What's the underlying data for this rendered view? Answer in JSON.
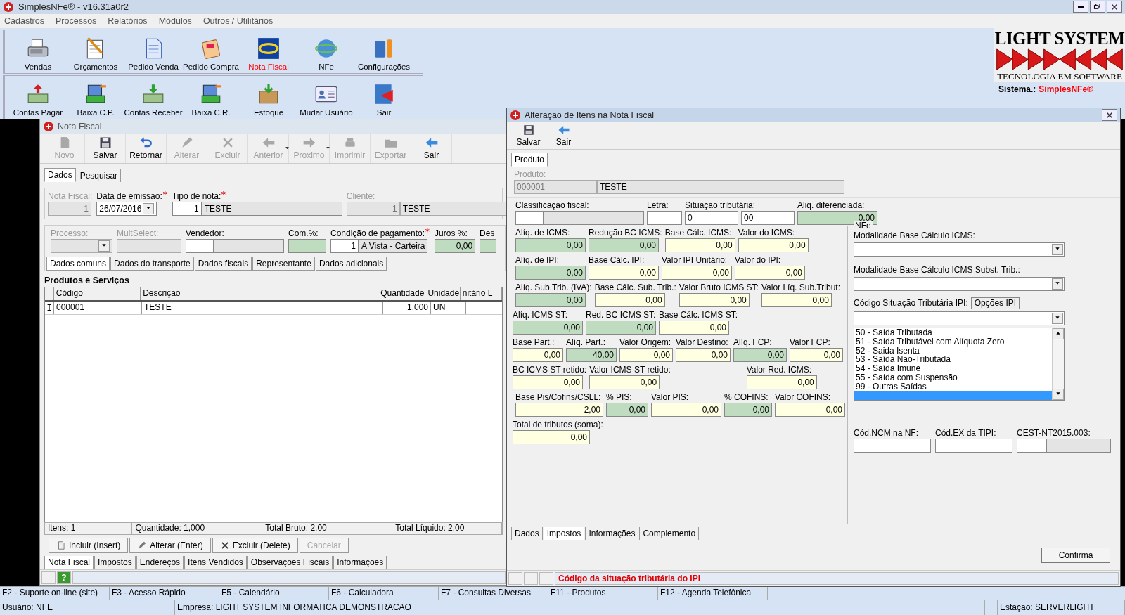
{
  "window": {
    "title": "SimplesNFe®  - v16.31a0r2"
  },
  "menu": [
    "Cadastros",
    "Processos",
    "Relatórios",
    "Módulos",
    "Outros / Utilitários"
  ],
  "launcher": [
    [
      {
        "label": "Vendas",
        "active": false
      },
      {
        "label": "Orçamentos",
        "active": false
      },
      {
        "label": "Pedido Venda",
        "active": false
      },
      {
        "label": "Pedido Compra",
        "active": false
      },
      {
        "label": "Nota Fiscal",
        "active": true
      },
      {
        "label": "NFe",
        "active": false
      },
      {
        "label": "Configurações",
        "active": false
      }
    ],
    [
      {
        "label": "Contas Pagar",
        "active": false
      },
      {
        "label": "Baixa C.P.",
        "active": false
      },
      {
        "label": "Contas Receber",
        "active": false
      },
      {
        "label": "Baixa C.R.",
        "active": false
      },
      {
        "label": "Estoque",
        "active": false
      },
      {
        "label": "Mudar Usuário",
        "active": false
      },
      {
        "label": "Sair",
        "active": false
      }
    ]
  ],
  "logo": {
    "title": "LIGHT SYSTEM",
    "tagline": "TECNOLOGIA EM SOFTWARE",
    "system_label": "Sistema.:",
    "system_name": "SimplesNFe®"
  },
  "nota_fiscal": {
    "title": "Nota Fiscal",
    "toolbar": [
      {
        "label": "Novo",
        "disabled": true
      },
      {
        "label": "Salvar",
        "disabled": false
      },
      {
        "label": "Retornar",
        "disabled": false
      },
      {
        "label": "Alterar",
        "disabled": true
      },
      {
        "label": "Excluir",
        "disabled": true
      },
      {
        "label": "Anterior",
        "disabled": true,
        "dropdown": true
      },
      {
        "label": "Proximo",
        "disabled": true,
        "dropdown": true
      },
      {
        "label": "Imprimir",
        "disabled": true
      },
      {
        "label": "Exportar",
        "disabled": true
      },
      {
        "label": "Sair",
        "disabled": false
      }
    ],
    "tabs": [
      {
        "label": "Dados",
        "selected": true
      },
      {
        "label": "Pesquisar",
        "selected": false
      }
    ],
    "header_fields": [
      {
        "label": "Nota Fiscal:",
        "disabled": true,
        "parts": [
          {
            "value": "1",
            "kind": "readonly_code"
          }
        ]
      },
      {
        "label": "Data de emissão:",
        "disabled": false,
        "required": true,
        "dropdown": true,
        "parts": [
          {
            "value": "26/07/2016",
            "kind": "input"
          }
        ]
      },
      {
        "label": "Tipo de nota:",
        "disabled": false,
        "required": true,
        "parts": [
          {
            "value": "1",
            "kind": "code"
          },
          {
            "value": "TESTE",
            "kind": "name"
          }
        ]
      },
      {
        "label": "Cliente:",
        "disabled": true,
        "parts": [
          {
            "value": "1",
            "kind": "readonly_code"
          },
          {
            "value": "TESTE",
            "kind": "name"
          }
        ]
      },
      {
        "parts": [
          {
            "kind": "input"
          }
        ]
      }
    ],
    "detail_fields": [
      {
        "label": "Processo:",
        "disabled": true,
        "dropdown": true,
        "parts": [
          {
            "kind": "readonly"
          }
        ]
      },
      {
        "label": "MultSelect:",
        "disabled": true,
        "parts": [
          {
            "kind": "readonly"
          }
        ]
      },
      {
        "label": "Vendedor:",
        "disabled": false,
        "parts": [
          {
            "kind": "code"
          },
          {
            "kind": "name"
          }
        ]
      },
      {
        "label": "Com.%:",
        "disabled": false,
        "parts": [
          {
            "kind": "rate"
          }
        ]
      },
      {
        "label": "Condição de pagamento:",
        "disabled": false,
        "required": true,
        "parts": [
          {
            "value": "1",
            "kind": "code"
          },
          {
            "value": "A Vista - Carteira",
            "kind": "name"
          }
        ]
      },
      {
        "label": "Juros %:",
        "disabled": false,
        "parts": [
          {
            "value": "0,00",
            "kind": "rate"
          }
        ]
      },
      {
        "label": "Des",
        "disabled": false,
        "parts": [
          {
            "kind": "rate"
          }
        ]
      }
    ],
    "sub_tabs": [
      {
        "label": "Dados comuns",
        "selected": true
      },
      {
        "label": "Dados do transporte",
        "selected": false
      },
      {
        "label": "Dados fiscais",
        "selected": false
      },
      {
        "label": "Representante",
        "selected": false
      },
      {
        "label": "Dados adicionais",
        "selected": false
      }
    ],
    "section_title": "Produtos e Serviços",
    "table": {
      "columns": [
        "Código",
        "Descrição",
        "Quantidade",
        "Unidade",
        "nitário L"
      ],
      "rows": [
        {
          "editing": true,
          "cells": [
            "000001",
            "TESTE",
            "1,000",
            "UN"
          ]
        }
      ]
    },
    "totals": [
      "Itens: 1",
      "Quantidade: 1,000",
      "Total Bruto: 2,00",
      "Total Líquido: 2,00"
    ],
    "actions": [
      {
        "label": "Incluir (Insert)",
        "disabled": false
      },
      {
        "label": "Alterar (Enter)",
        "disabled": false
      },
      {
        "label": "Excluir (Delete)",
        "disabled": false
      },
      {
        "label": "Cancelar",
        "disabled": true
      }
    ],
    "bottom_tabs": [
      {
        "label": "Nota Fiscal",
        "selected": true
      },
      {
        "label": "Impostos",
        "selected": false
      },
      {
        "label": "Endereços",
        "selected": false
      },
      {
        "label": "Itens Vendidos",
        "selected": false
      },
      {
        "label": "Observações Fiscais",
        "selected": false
      },
      {
        "label": "Informações",
        "selected": false
      }
    ],
    "help": "?"
  },
  "dialog": {
    "title": "Alteração de Itens na Nota Fiscal",
    "toolbar": [
      {
        "label": "Salvar",
        "disabled": false
      },
      {
        "label": "Sair",
        "disabled": false
      }
    ],
    "tabs": [
      {
        "label": "Produto",
        "selected": true
      }
    ],
    "product": {
      "label": "Produto:",
      "disabled": true,
      "parts": [
        {
          "value": "000001",
          "kind": "readonly"
        },
        {
          "value": "TESTE",
          "kind": "name"
        }
      ]
    },
    "tax_rows": [
      [
        {
          "label": "Classificação fiscal:",
          "parts": [
            {
              "kind": "input"
            },
            {
              "kind": "name"
            }
          ]
        },
        {
          "label": "Letra:",
          "parts": [
            {
              "kind": "input"
            }
          ]
        },
        {
          "label": "Situação tributária:",
          "parts": [
            {
              "value": "0",
              "kind": "input"
            },
            {
              "value": "00",
              "kind": "input"
            }
          ]
        },
        {
          "label": "Aliq. diferenciada:",
          "parts": [
            {
              "value": "0,00",
              "kind": "rate"
            }
          ]
        }
      ],
      [
        {
          "label": "Alíq. de ICMS:",
          "parts": [
            {
              "value": "0,00",
              "kind": "rate"
            }
          ]
        },
        {
          "label": "Redução BC ICMS:",
          "parts": [
            {
              "value": "0,00",
              "kind": "rate"
            }
          ]
        },
        {
          "label": "Base Cálc. ICMS:",
          "parts": [
            {
              "value": "0,00",
              "kind": "amount"
            }
          ]
        },
        {
          "label": "Valor do ICMS:",
          "parts": [
            {
              "value": "0,00",
              "kind": "amount"
            }
          ]
        }
      ],
      [
        {
          "label": "Alíq. de IPI:",
          "parts": [
            {
              "value": "0,00",
              "kind": "rate"
            }
          ]
        },
        {
          "label": "Base Cálc. IPI:",
          "parts": [
            {
              "value": "0,00",
              "kind": "amount"
            }
          ]
        },
        {
          "label": "Valor IPI Unitário:",
          "parts": [
            {
              "value": "0,00",
              "kind": "amount"
            }
          ]
        },
        {
          "label": "Valor do IPI:",
          "parts": [
            {
              "value": "0,00",
              "kind": "amount"
            }
          ]
        }
      ],
      [
        {
          "label": "Alíq. Sub.Trib. (IVA):",
          "parts": [
            {
              "value": "0,00",
              "kind": "rate"
            }
          ]
        },
        {
          "label": "Base Cálc. Sub. Trib.:",
          "parts": [
            {
              "value": "0,00",
              "kind": "amount"
            }
          ]
        },
        {
          "label": "Valor Bruto ICMS ST:",
          "parts": [
            {
              "value": "0,00",
              "kind": "amount"
            }
          ]
        },
        {
          "label": "Valor Líq. Sub.Tribut:",
          "parts": [
            {
              "value": "0,00",
              "kind": "amount"
            }
          ]
        }
      ],
      [
        {
          "label": "Alíq. ICMS ST:",
          "parts": [
            {
              "value": "0,00",
              "kind": "rate"
            }
          ]
        },
        {
          "label": "Red. BC ICMS ST:",
          "parts": [
            {
              "value": "0,00",
              "kind": "rate"
            }
          ]
        },
        {
          "label": "Base Cálc. ICMS ST:",
          "parts": [
            {
              "value": "0,00",
              "kind": "amount"
            }
          ]
        }
      ],
      [
        {
          "label": "Base Part.:",
          "parts": [
            {
              "value": "0,00",
              "kind": "amount"
            }
          ]
        },
        {
          "label": "Alíq. Part.:",
          "parts": [
            {
              "value": "40,00",
              "kind": "rate"
            }
          ]
        },
        {
          "label": "Valor Origem:",
          "parts": [
            {
              "value": "0,00",
              "kind": "amount"
            }
          ]
        },
        {
          "label": "Valor Destino:",
          "parts": [
            {
              "value": "0,00",
              "kind": "amount"
            }
          ]
        },
        {
          "label": "Alíq. FCP:",
          "parts": [
            {
              "value": "0,00",
              "kind": "rate"
            }
          ]
        },
        {
          "label": "Valor FCP:",
          "parts": [
            {
              "value": "0,00",
              "kind": "amount"
            }
          ]
        }
      ],
      [
        {
          "label": "BC ICMS ST retido:",
          "parts": [
            {
              "value": "0,00",
              "kind": "amount"
            }
          ]
        },
        {
          "label": "Valor ICMS ST retido:",
          "parts": [
            {
              "value": "0,00",
              "kind": "amount"
            }
          ]
        },
        {
          "label": "Valor Red. ICMS:",
          "parts": [
            {
              "value": "0,00",
              "kind": "amount"
            }
          ]
        }
      ],
      [
        {
          "label": "Base Pis/Cofins/CSLL:",
          "parts": [
            {
              "value": "2,00",
              "kind": "amount"
            }
          ]
        },
        {
          "label": "% PIS:",
          "parts": [
            {
              "value": "0,00",
              "kind": "rate"
            }
          ]
        },
        {
          "label": "Valor PIS:",
          "parts": [
            {
              "value": "0,00",
              "kind": "amount"
            }
          ]
        },
        {
          "label": "% COFINS:",
          "parts": [
            {
              "value": "0,00",
              "kind": "rate"
            }
          ]
        },
        {
          "label": "Valor COFINS:",
          "parts": [
            {
              "value": "0,00",
              "kind": "amount"
            }
          ]
        }
      ],
      [
        {
          "label": "Total de tributos (soma):",
          "parts": [
            {
              "value": "0,00",
              "kind": "amount"
            }
          ]
        }
      ]
    ],
    "nfe": {
      "title": "NFe",
      "icms_mode": {
        "label": "Modalidade Base Cálculo ICMS:"
      },
      "icms_st_mode": {
        "label": "Modalidade Base Cálculo ICMS Subst. Trib.:"
      },
      "ipi_cst": {
        "label": "Código Situação Tributária IPI:",
        "button": "Opções IPI",
        "options": [
          {
            "label": "50 - Saída Tributada",
            "selected": false
          },
          {
            "label": "51 - Saída Tributável com Alíquota Zero",
            "selected": false
          },
          {
            "label": "52 - Saida Isenta",
            "selected": false
          },
          {
            "label": "53 - Saída Não-Tributada",
            "selected": false
          },
          {
            "label": "54 - Saída Imune",
            "selected": false
          },
          {
            "label": "55 - Saída com Suspensão",
            "selected": false
          },
          {
            "label": "99 - Outras Saídas",
            "selected": false
          },
          {
            "selected": true
          }
        ]
      },
      "codes": [
        {
          "label": "Cód.NCM na NF:",
          "parts": [
            {
              "kind": "input"
            }
          ]
        },
        {
          "label": "Cód.EX da TIPI:",
          "parts": [
            {
              "kind": "input"
            }
          ]
        },
        {
          "label": "CEST-NT2015.003:",
          "parts": [
            {
              "kind": "input"
            },
            {
              "kind": "name"
            }
          ]
        }
      ]
    },
    "bottom_tabs": [
      {
        "label": "Dados",
        "selected": false
      },
      {
        "label": "Impostos",
        "selected": true
      },
      {
        "label": "Informações",
        "selected": false
      },
      {
        "label": "Complemento",
        "selected": false
      }
    ],
    "confirm": "Confirma",
    "status": "Código da situação tributária do IPI"
  },
  "function_keys": [
    "F2 - Suporte on-line (site)",
    "F3 - Acesso Rápido",
    "F5 - Calendário",
    "F6 - Calculadora",
    "F7 - Consultas Diversas",
    "F11 - Produtos",
    "F12 - Agenda Telefônica"
  ],
  "status_bar": {
    "user": "Usuário: NFE",
    "company": "Empresa: LIGHT SYSTEM INFORMATICA DEMONSTRACAO",
    "station": "Estação: SERVERLIGHT"
  }
}
